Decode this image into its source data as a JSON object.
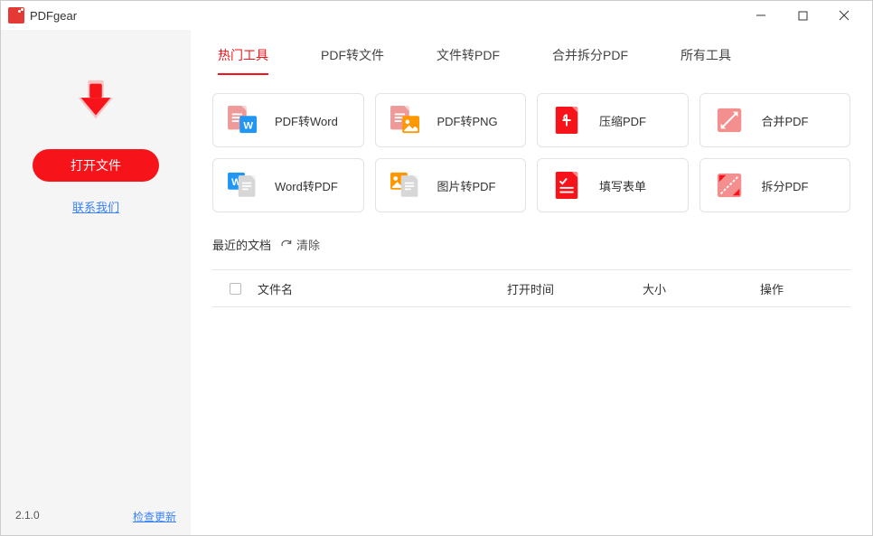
{
  "app": {
    "title": "PDFgear"
  },
  "sidebar": {
    "open_label": "打开文件",
    "contact_label": "联系我们",
    "version": "2.1.0",
    "update_label": "检查更新"
  },
  "tabs": [
    {
      "label": "热门工具",
      "active": true
    },
    {
      "label": "PDF转文件",
      "active": false
    },
    {
      "label": "文件转PDF",
      "active": false
    },
    {
      "label": "合并拆分PDF",
      "active": false
    },
    {
      "label": "所有工具",
      "active": false
    }
  ],
  "tools": [
    {
      "id": "pdf-to-word",
      "label": "PDF转Word"
    },
    {
      "id": "pdf-to-png",
      "label": "PDF转PNG"
    },
    {
      "id": "compress-pdf",
      "label": "压缩PDF"
    },
    {
      "id": "merge-pdf",
      "label": "合并PDF"
    },
    {
      "id": "word-to-pdf",
      "label": "Word转PDF"
    },
    {
      "id": "image-to-pdf",
      "label": "图片转PDF"
    },
    {
      "id": "fill-form",
      "label": "填写表单"
    },
    {
      "id": "split-pdf",
      "label": "拆分PDF"
    }
  ],
  "recent": {
    "title": "最近的文档",
    "clear_label": "清除",
    "columns": {
      "name": "文件名",
      "time": "打开时间",
      "size": "大小",
      "ops": "操作"
    }
  }
}
